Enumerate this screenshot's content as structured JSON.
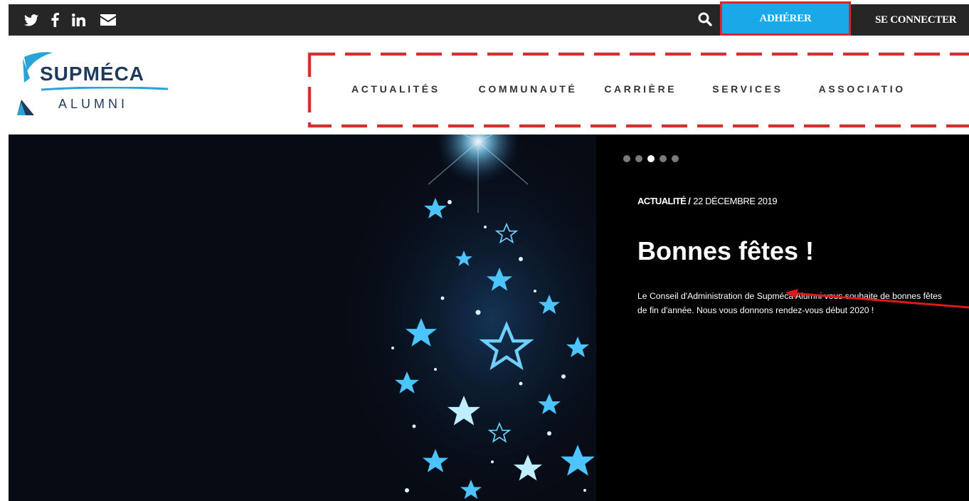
{
  "topbar": {
    "social": [
      {
        "icon": "twitter-icon"
      },
      {
        "icon": "facebook-icon"
      },
      {
        "icon": "linkedin-icon"
      },
      {
        "icon": "email-icon"
      }
    ],
    "search_icon": "search-icon",
    "join_label": "ADHÉRER",
    "login_label": "SE CONNECTER"
  },
  "logo": {
    "name": "SUPMÉCA",
    "sub": "ALUMNI"
  },
  "nav": {
    "items": [
      "ACTUALITÉS",
      "COMMUNAUTÉ",
      "CARRIÈRE",
      "SERVICES",
      "ASSOCIATIO"
    ]
  },
  "hero": {
    "slides_count": 5,
    "active_slide": 3,
    "category": "ACTUALITÉ /",
    "date": "22 DÉCEMBRE 2019",
    "title": "Bonnes fêtes !",
    "body": "Le Conseil d'Administration de Supméca Alumni vous souhaite de bonnes fêtes de fin d'année. Nous vous donnons rendez-vous début 2020 !"
  },
  "colors": {
    "topbar_bg": "#262626",
    "join_bg": "#19a8e8",
    "highlight_red": "#d9272e",
    "logo_navy": "#1f3a5c",
    "logo_blue": "#2aa3d8"
  }
}
